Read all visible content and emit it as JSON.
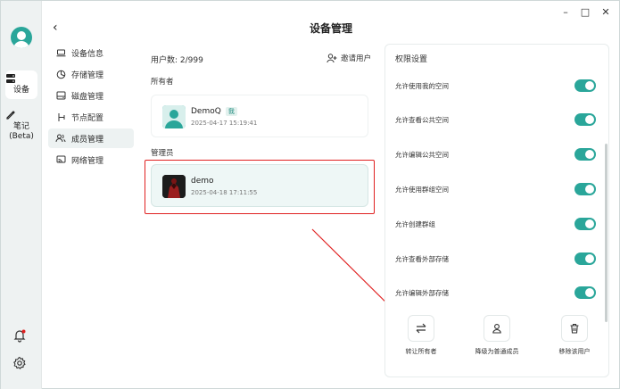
{
  "window": {
    "title": "设备管理"
  },
  "rail": {
    "items": [
      {
        "label": "设备",
        "icon": "device-icon",
        "active": true
      },
      {
        "label": "笔记\n(Beta)",
        "icon": "note-icon",
        "active": false
      }
    ]
  },
  "nav": {
    "items": [
      {
        "label": "设备信息",
        "icon": "laptop-icon"
      },
      {
        "label": "存储管理",
        "icon": "pie-chart-icon"
      },
      {
        "label": "磁盘管理",
        "icon": "disk-icon"
      },
      {
        "label": "节点配置",
        "icon": "node-config-icon"
      },
      {
        "label": "成员管理",
        "icon": "members-icon",
        "active": true
      },
      {
        "label": "网络管理",
        "icon": "network-icon"
      }
    ]
  },
  "main": {
    "users_count": "用户数: 2/999",
    "invite_label": "邀请用户",
    "owner_section": "所有者",
    "admin_section": "管理员",
    "owner": {
      "name": "DemoQ",
      "badge": "我",
      "date": "2025-04-17 15:19:41"
    },
    "admin": {
      "name": "demo",
      "date": "2025-04-18 17:11:55"
    }
  },
  "permissions": {
    "title": "权限设置",
    "items": [
      {
        "label": "允许使用我的空间",
        "on": true
      },
      {
        "label": "允许查看公共空间",
        "on": true
      },
      {
        "label": "允许编辑公共空间",
        "on": true
      },
      {
        "label": "允许使用群组空间",
        "on": true
      },
      {
        "label": "允许创建群组",
        "on": true
      },
      {
        "label": "允许查看外部存储",
        "on": true
      },
      {
        "label": "允许编辑外部存储",
        "on": true
      }
    ],
    "actions": [
      {
        "label": "转让所有者",
        "icon": "transfer-icon"
      },
      {
        "label": "降级为普通成员",
        "icon": "user-icon"
      },
      {
        "label": "移除该用户",
        "icon": "trash-icon"
      }
    ]
  },
  "colors": {
    "accent": "#2aa69a",
    "annotation": "#e02020"
  }
}
